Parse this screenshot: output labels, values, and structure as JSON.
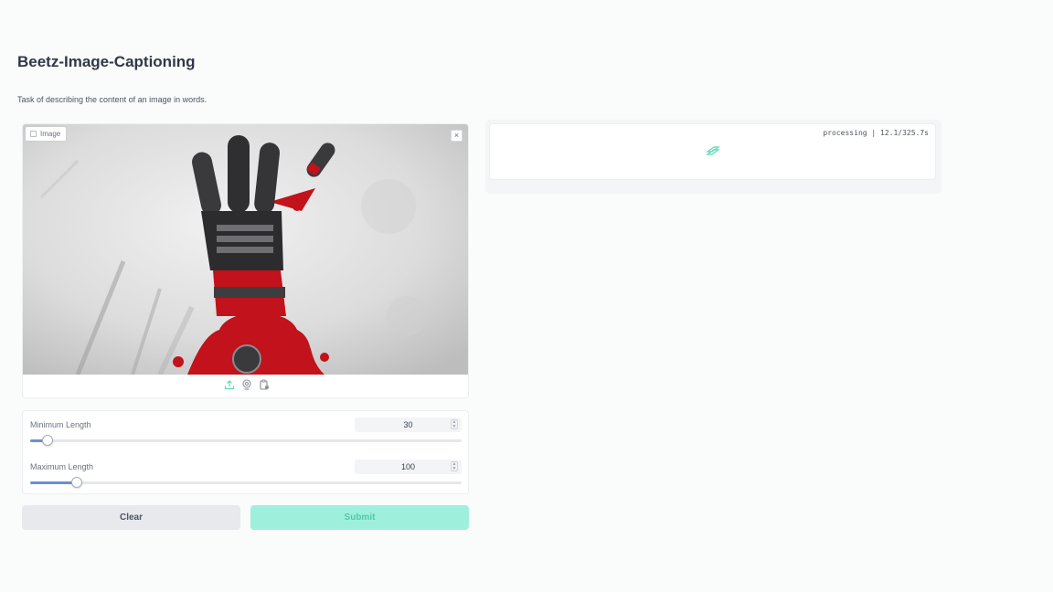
{
  "app": {
    "title": "Beetz-Image-Captioning",
    "description": "Task of describing the content of an image in words."
  },
  "image_input": {
    "label": "Image",
    "close_symbol": "×",
    "tools": [
      "upload-icon",
      "webcam-icon",
      "clipboard-icon"
    ]
  },
  "sliders": [
    {
      "label": "Minimum Length",
      "value": "30",
      "fraction": 0.04
    },
    {
      "label": "Maximum Length",
      "value": "100",
      "fraction": 0.108
    }
  ],
  "buttons": {
    "clear": "Clear",
    "submit": "Submit"
  },
  "output": {
    "status": "processing | 12.1/325.7s"
  },
  "colors": {
    "accent": "#5fd8b6",
    "slider_fill": "#6b8fd4",
    "submit_bg": "#9ef0dd",
    "submit_text": "#54c7a7",
    "blood_red": "#c2121b"
  }
}
